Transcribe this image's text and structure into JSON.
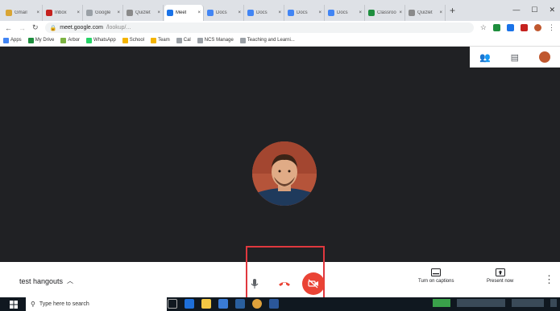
{
  "tabs": [
    {
      "title": "Gmail",
      "color": "#d9a534"
    },
    {
      "title": "Inbox",
      "color": "#c5221f"
    },
    {
      "title": "Google",
      "color": "#9aa0a6"
    },
    {
      "title": "Quizlet",
      "color": "#8a8a8a"
    },
    {
      "title": "Meet",
      "color": "#1a73e8",
      "active": true
    },
    {
      "title": "Docs",
      "color": "#4285f4"
    },
    {
      "title": "Docs",
      "color": "#4285f4"
    },
    {
      "title": "Docs",
      "color": "#4285f4"
    },
    {
      "title": "Docs",
      "color": "#4285f4"
    },
    {
      "title": "Classroom",
      "color": "#1e8e3e"
    },
    {
      "title": "Quizlet",
      "color": "#8a8a8a"
    }
  ],
  "address": {
    "host": "meet.google.com",
    "path": "/lookup/..."
  },
  "bookmarks": [
    {
      "label": "Apps",
      "color": "#4285f4"
    },
    {
      "label": "My Drive",
      "color": "#1e8e3e"
    },
    {
      "label": "Arbor",
      "color": "#7cb342"
    },
    {
      "label": "WhatsApp",
      "color": "#25d366"
    },
    {
      "label": "School",
      "color": "#f4b400"
    },
    {
      "label": "Team",
      "color": "#f4b400"
    },
    {
      "label": "Cal",
      "color": "#9aa0a6"
    },
    {
      "label": "NCS Manage",
      "color": "#9aa0a6"
    },
    {
      "label": "Teaching and Learni...",
      "color": "#9aa0a6"
    }
  ],
  "meeting": {
    "name": "test hangouts"
  },
  "controls": {
    "captions_label": "Turn on captions",
    "present_label": "Present now"
  },
  "taskbar": {
    "search_placeholder": "Type here to search"
  },
  "colors": {
    "stage_bg": "#202124",
    "hangup_red": "#ea4335",
    "highlight_box": "#e0383e"
  }
}
